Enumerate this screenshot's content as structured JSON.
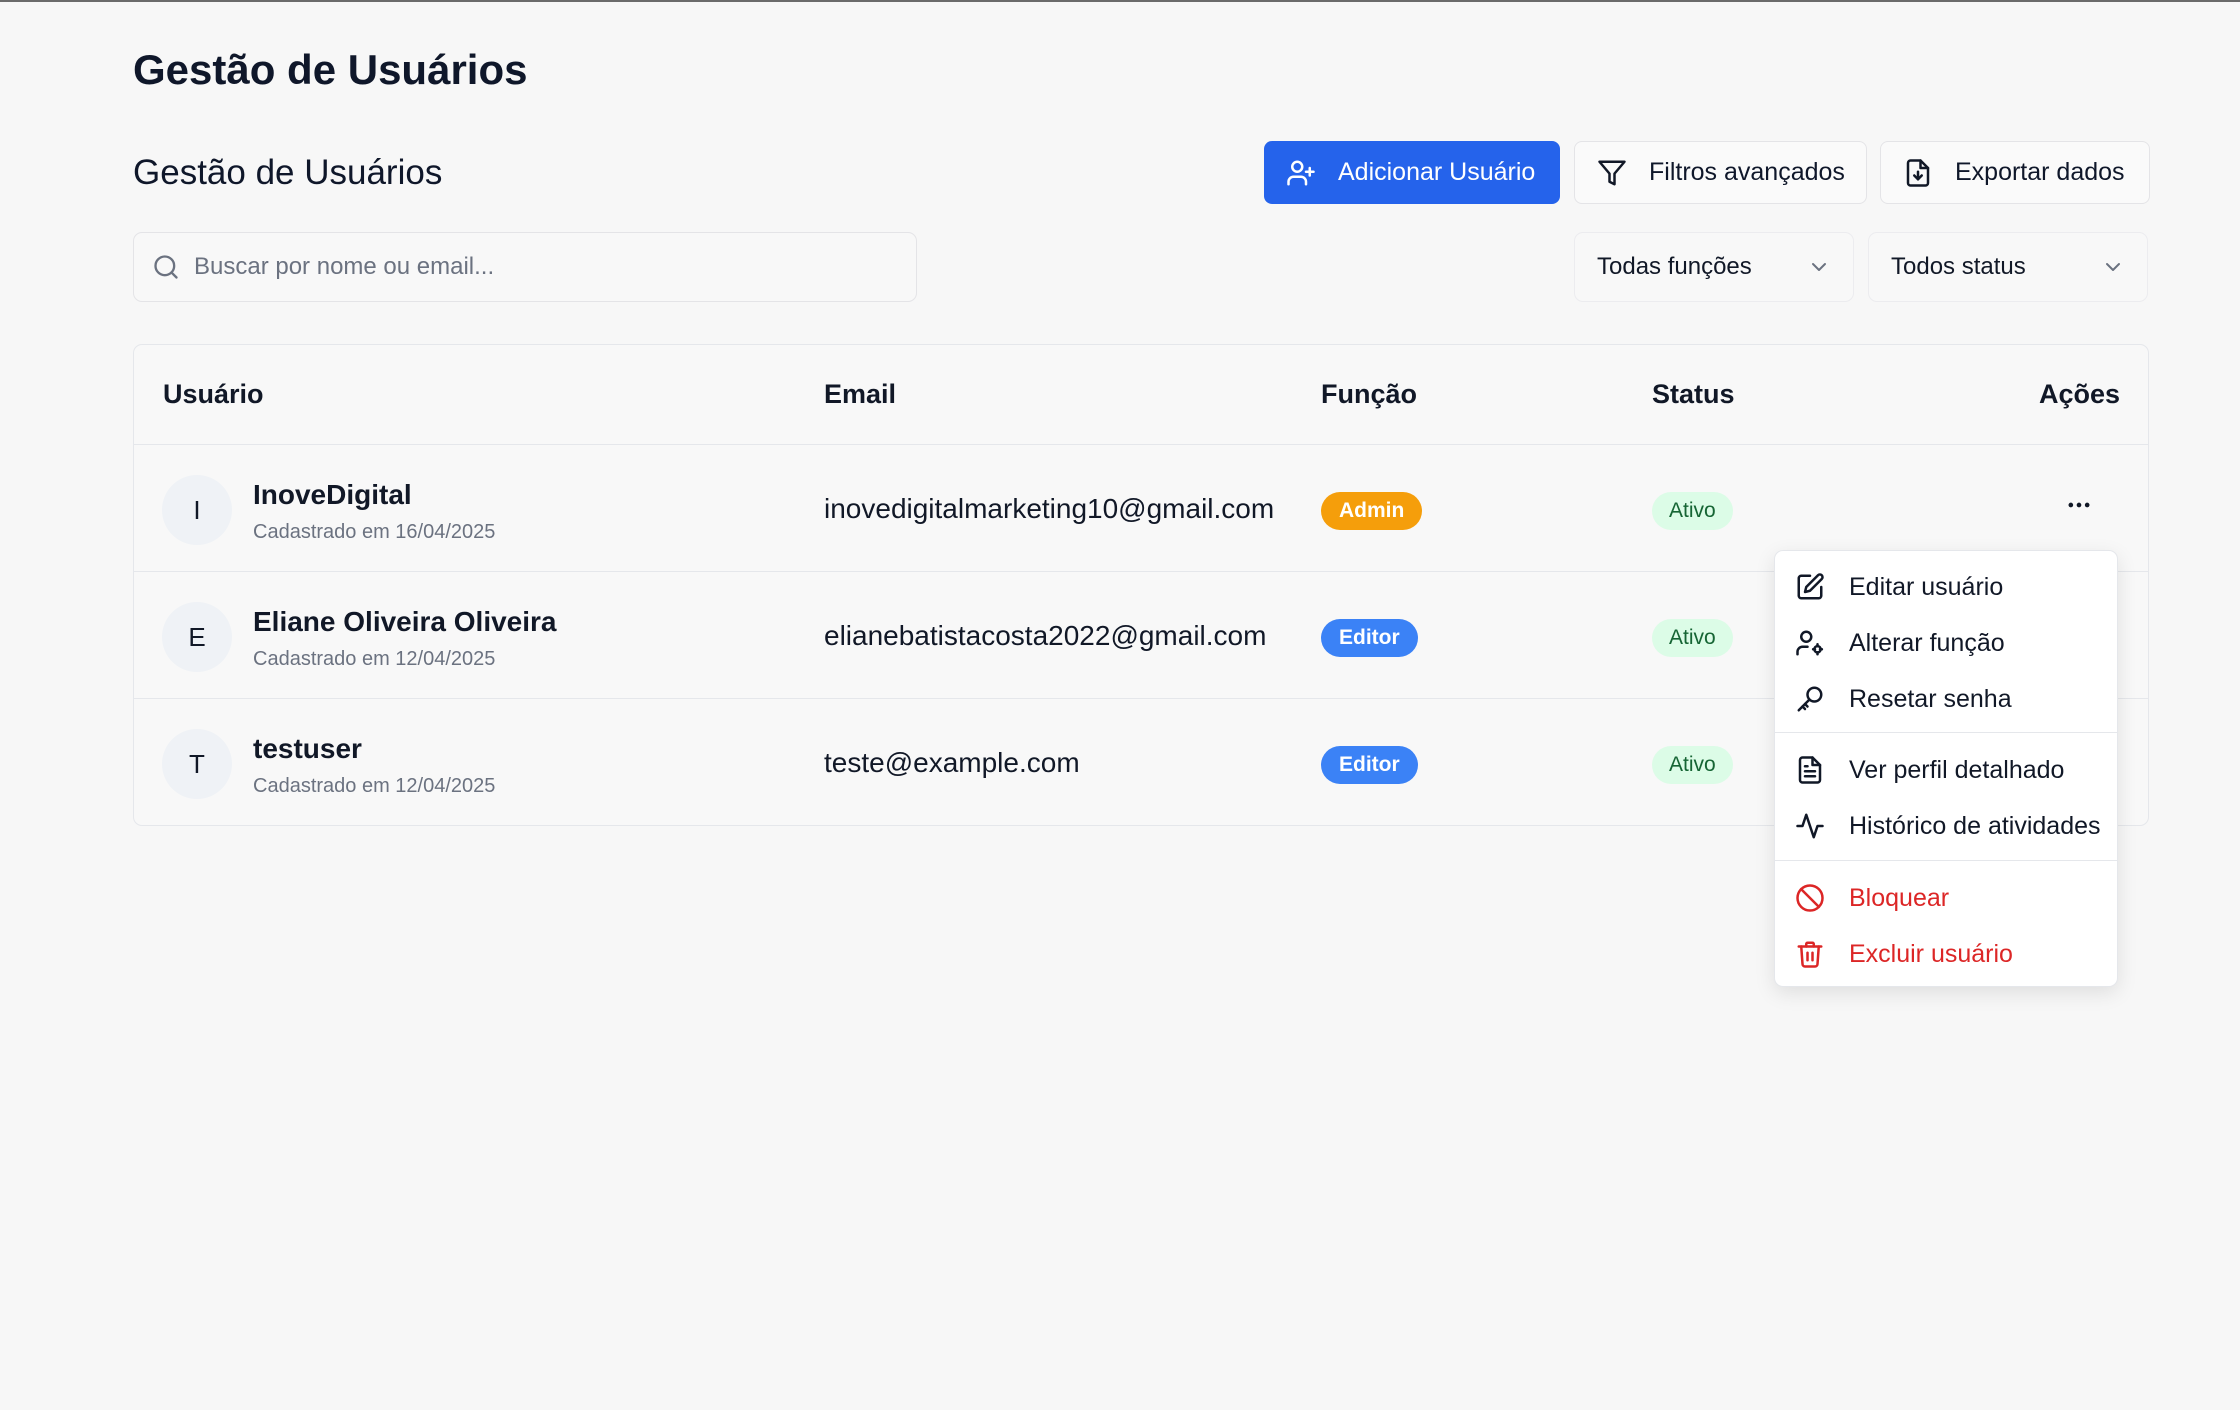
{
  "page": {
    "title": "Gestão de Usuários",
    "section_title": "Gestão de Usuários"
  },
  "toolbar": {
    "add_user_label": "Adicionar Usuário",
    "filters_label": "Filtros avançados",
    "export_label": "Exportar dados"
  },
  "search": {
    "placeholder": "Buscar por nome ou email...",
    "value": ""
  },
  "filters": {
    "role_selected": "Todas funções",
    "status_selected": "Todos status"
  },
  "table": {
    "headers": {
      "user": "Usuário",
      "email": "Email",
      "role": "Função",
      "status": "Status",
      "actions": "Ações"
    },
    "rows": [
      {
        "initial": "I",
        "name": "InoveDigital",
        "registered": "Cadastrado em 16/04/2025",
        "email": "inovedigitalmarketing10@gmail.com",
        "role": "Admin",
        "role_color": "#f59e0b",
        "status": "Ativo"
      },
      {
        "initial": "E",
        "name": "Eliane Oliveira Oliveira",
        "registered": "Cadastrado em 12/04/2025",
        "email": "elianebatistacosta2022@gmail.com",
        "role": "Editor",
        "role_color": "#3b82f6",
        "status": "Ativo"
      },
      {
        "initial": "T",
        "name": "testuser",
        "registered": "Cadastrado em 12/04/2025",
        "email": "teste@example.com",
        "role": "Editor",
        "role_color": "#3b82f6",
        "status": "Ativo"
      }
    ]
  },
  "actions_menu": {
    "items": [
      {
        "label": "Editar usuário",
        "icon": "edit-icon"
      },
      {
        "label": "Alterar função",
        "icon": "user-cog-icon"
      },
      {
        "label": "Resetar senha",
        "icon": "key-icon"
      },
      {
        "label": "Ver perfil detalhado",
        "icon": "file-text-icon"
      },
      {
        "label": "Histórico de atividades",
        "icon": "activity-icon"
      },
      {
        "label": "Bloquear",
        "icon": "ban-icon"
      },
      {
        "label": "Excluir usuário",
        "icon": "trash-icon"
      }
    ]
  },
  "colors": {
    "primary": "#2563eb",
    "danger": "#dc2626",
    "admin_badge": "#f59e0b",
    "editor_badge": "#3b82f6",
    "active_badge_bg": "#dcfce7",
    "active_badge_text": "#166534"
  }
}
